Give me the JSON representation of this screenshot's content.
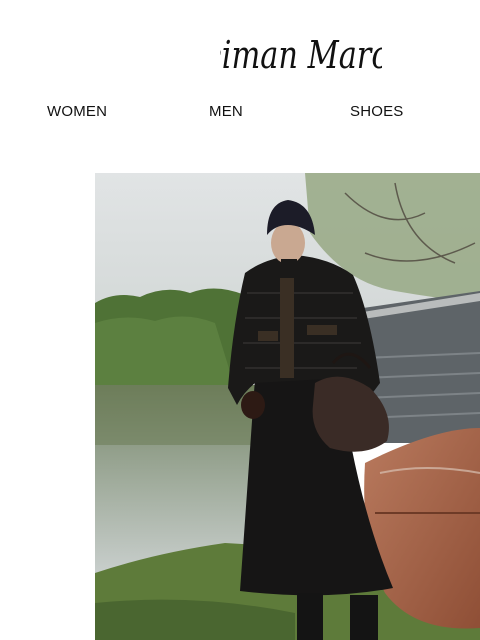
{
  "brand": {
    "name": "Neiman Marcus"
  },
  "nav": {
    "items": [
      {
        "label": "WOMEN"
      },
      {
        "label": "MEN"
      },
      {
        "label": "SHOES"
      }
    ]
  },
  "hero": {
    "image_semantic": "model-in-black-puffer-jacket-and-skirt-by-lake",
    "colors": {
      "sky": "#dcdfe0",
      "water": "#8f9a8e",
      "trees": "#4e7033",
      "grass": "#5f7a3c",
      "outfit": "#151414",
      "boat": "#a8664b",
      "shed": "#5f6468"
    }
  }
}
